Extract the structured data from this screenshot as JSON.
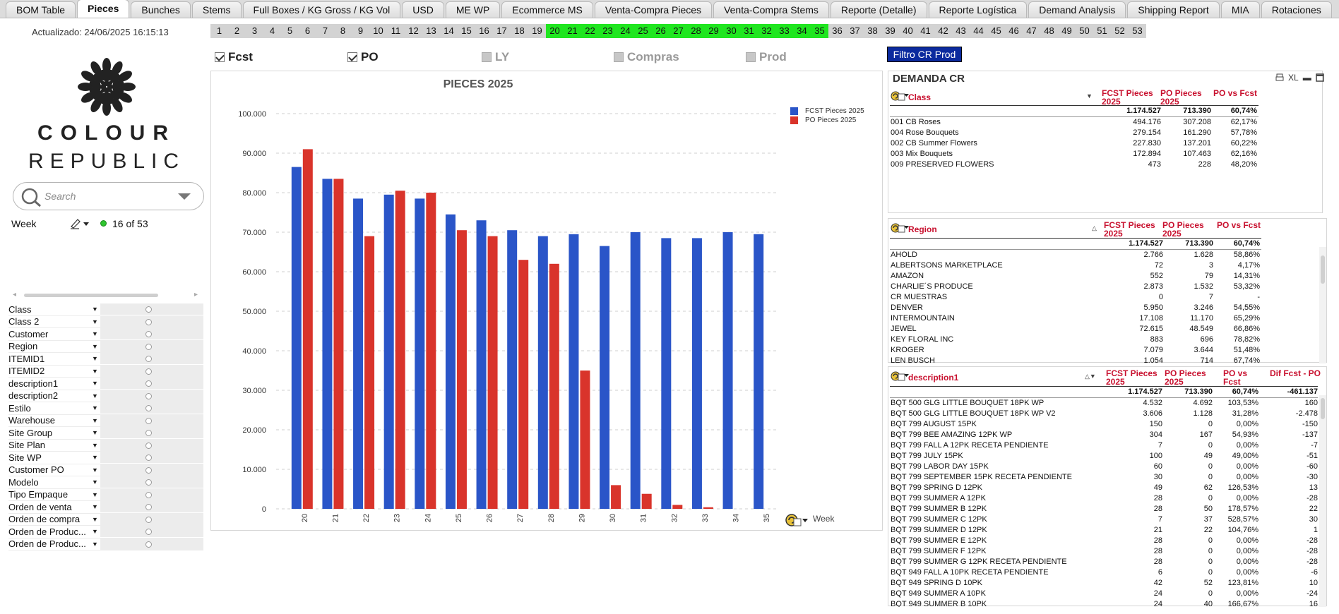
{
  "tabs": [
    "BOM Table",
    "Pieces",
    "Bunches",
    "Stems",
    "Full Boxes / KG Gross / KG Vol",
    "USD",
    "ME WP",
    "Ecommerce MS",
    "Venta-Compra Pieces",
    "Venta-Compra Stems",
    "Reporte (Detalle)",
    "Reporte Logística",
    "Demand Analysis",
    "Shipping Report",
    "MIA",
    "Rotaciones"
  ],
  "active_tab": "Pieces",
  "updated": "Actualizado: 24/06/2025     16:15:13",
  "logo": {
    "line1": "COLOUR",
    "line2": "REPUBLIC"
  },
  "search": {
    "placeholder": "Search"
  },
  "week_filter": {
    "label": "Week",
    "count": "16 of 53"
  },
  "filters": [
    "Class",
    "Class 2",
    "Customer",
    "Region",
    "ITEMID1",
    "ITEMID2",
    "description1",
    "description2",
    "Estilo",
    "Warehouse",
    "Site Group",
    "Site Plan",
    "Site WP",
    "Customer PO",
    "Modelo",
    "Tipo Empaque",
    "Orden de venta",
    "Orden de compra",
    "Orden de Produc...",
    "Orden de Produc..."
  ],
  "weeks": [
    "1",
    "2",
    "3",
    "4",
    "5",
    "6",
    "7",
    "8",
    "9",
    "10",
    "11",
    "12",
    "13",
    "14",
    "15",
    "16",
    "17",
    "18",
    "19",
    "20",
    "21",
    "22",
    "23",
    "24",
    "25",
    "26",
    "27",
    "28",
    "29",
    "30",
    "31",
    "32",
    "33",
    "34",
    "35",
    "36",
    "37",
    "38",
    "39",
    "40",
    "41",
    "42",
    "43",
    "44",
    "45",
    "46",
    "47",
    "48",
    "49",
    "50",
    "51",
    "52",
    "53"
  ],
  "selected_weeks": [
    "20",
    "21",
    "22",
    "23",
    "24",
    "25",
    "26",
    "27",
    "28",
    "29",
    "30",
    "31",
    "32",
    "33",
    "34",
    "35"
  ],
  "checkboxes": [
    {
      "label": "Fcst",
      "checked": true
    },
    {
      "label": "PO",
      "checked": true
    },
    {
      "label": "LY",
      "checked": false
    },
    {
      "label": "Compras",
      "checked": false
    },
    {
      "label": "Prod",
      "checked": false
    }
  ],
  "filter_button": "Filtro CR Prod",
  "colors": {
    "fcst": "#2a55c8",
    "po": "#d9342b",
    "selected_week": "#20e620",
    "header_red": "#c8102e"
  },
  "chart_data": {
    "type": "bar",
    "title": "PIECES 2025",
    "xlabel": "Week",
    "ylim": [
      0,
      100000
    ],
    "yticks": [
      "0",
      "10.000",
      "20.000",
      "30.000",
      "40.000",
      "50.000",
      "60.000",
      "70.000",
      "80.000",
      "90.000",
      "100.000"
    ],
    "categories": [
      "20",
      "21",
      "22",
      "23",
      "24",
      "25",
      "26",
      "27",
      "28",
      "29",
      "30",
      "31",
      "32",
      "33",
      "34",
      "35"
    ],
    "series": [
      {
        "name": "FCST Pieces 2025",
        "values": [
          86500,
          83500,
          78500,
          79500,
          78500,
          74500,
          73000,
          70500,
          69000,
          69500,
          66500,
          70000,
          68500,
          68500,
          70000,
          69500
        ]
      },
      {
        "name": "PO Pieces 2025",
        "values": [
          91000,
          83500,
          69000,
          80500,
          80000,
          70500,
          69000,
          63000,
          62000,
          35000,
          6000,
          3800,
          1000,
          400,
          0,
          0
        ]
      }
    ]
  },
  "demanda": {
    "title": "DEMANDA CR",
    "toolbar": "XL",
    "class_table": {
      "headers": [
        "Class",
        "FCST Pieces 2025",
        "PO Pieces 2025",
        "PO vs Fcst"
      ],
      "total": [
        "1.174.527",
        "713.390",
        "60,74%"
      ],
      "rows": [
        [
          "001 CB Roses",
          "494.176",
          "307.208",
          "62,17%"
        ],
        [
          "004 Rose Bouquets",
          "279.154",
          "161.290",
          "57,78%"
        ],
        [
          "002 CB Summer Flowers",
          "227.830",
          "137.201",
          "60,22%"
        ],
        [
          "003 Mix Bouquets",
          "172.894",
          "107.463",
          "62,16%"
        ],
        [
          "009 PRESERVED FLOWERS",
          "473",
          "228",
          "48,20%"
        ]
      ]
    },
    "region_table": {
      "headers": [
        "Region",
        "FCST Pieces 2025",
        "PO Pieces 2025",
        "PO vs Fcst"
      ],
      "total": [
        "1.174.527",
        "713.390",
        "60,74%"
      ],
      "rows": [
        [
          "AHOLD",
          "2.766",
          "1.628",
          "58,86%"
        ],
        [
          "ALBERTSONS MARKETPLACE",
          "72",
          "3",
          "4,17%"
        ],
        [
          "AMAZON",
          "552",
          "79",
          "14,31%"
        ],
        [
          "CHARLIE´S PRODUCE",
          "2.873",
          "1.532",
          "53,32%"
        ],
        [
          "CR MUESTRAS",
          "0",
          "7",
          "-"
        ],
        [
          "DENVER",
          "5.950",
          "3.246",
          "54,55%"
        ],
        [
          "INTERMOUNTAIN",
          "17.108",
          "11.170",
          "65,29%"
        ],
        [
          "JEWEL",
          "72.615",
          "48.549",
          "66,86%"
        ],
        [
          "KEY FLORAL INC",
          "883",
          "696",
          "78,82%"
        ],
        [
          "KROGER",
          "7.079",
          "3.644",
          "51,48%"
        ],
        [
          "LEN BUSCH",
          "1.054",
          "714",
          "67,74%"
        ]
      ]
    },
    "desc_table": {
      "headers": [
        "description1",
        "FCST Pieces 2025",
        "PO Pieces 2025",
        "PO vs Fcst",
        "Dif Fcst - PO"
      ],
      "total": [
        "1.174.527",
        "713.390",
        "60,74%",
        "-461.137"
      ],
      "rows": [
        [
          "BQT 500 GLG LITTLE BOUQUET 18PK WP",
          "4.532",
          "4.692",
          "103,53%",
          "160"
        ],
        [
          "BQT 500 GLG LITTLE BOUQUET 18PK WP V2",
          "3.606",
          "1.128",
          "31,28%",
          "-2.478"
        ],
        [
          "BQT 799 AUGUST 15PK",
          "150",
          "0",
          "0,00%",
          "-150"
        ],
        [
          "BQT 799 BEE AMAZING 12PK WP",
          "304",
          "167",
          "54,93%",
          "-137"
        ],
        [
          "BQT 799 FALL A 12PK RECETA PENDIENTE",
          "7",
          "0",
          "0,00%",
          "-7"
        ],
        [
          "BQT 799 JULY 15PK",
          "100",
          "49",
          "49,00%",
          "-51"
        ],
        [
          "BQT 799 LABOR DAY 15PK",
          "60",
          "0",
          "0,00%",
          "-60"
        ],
        [
          "BQT 799 SEPTEMBER 15PK RECETA PENDIENTE",
          "30",
          "0",
          "0,00%",
          "-30"
        ],
        [
          "BQT 799 SPRING D 12PK",
          "49",
          "62",
          "126,53%",
          "13"
        ],
        [
          "BQT 799 SUMMER A 12PK",
          "28",
          "0",
          "0,00%",
          "-28"
        ],
        [
          "BQT 799 SUMMER B 12PK",
          "28",
          "50",
          "178,57%",
          "22"
        ],
        [
          "BQT 799 SUMMER C 12PK",
          "7",
          "37",
          "528,57%",
          "30"
        ],
        [
          "BQT 799 SUMMER D 12PK",
          "21",
          "22",
          "104,76%",
          "1"
        ],
        [
          "BQT 799 SUMMER E 12PK",
          "28",
          "0",
          "0,00%",
          "-28"
        ],
        [
          "BQT 799 SUMMER F 12PK",
          "28",
          "0",
          "0,00%",
          "-28"
        ],
        [
          "BQT 799 SUMMER G 12PK RECETA PENDIENTE",
          "28",
          "0",
          "0,00%",
          "-28"
        ],
        [
          "BQT 949 FALL A 10PK RECETA PENDIENTE",
          "6",
          "0",
          "0,00%",
          "-6"
        ],
        [
          "BQT 949 SPRING D 10PK",
          "42",
          "52",
          "123,81%",
          "10"
        ],
        [
          "BQT 949 SUMMER A 10PK",
          "24",
          "0",
          "0,00%",
          "-24"
        ],
        [
          "BQT 949 SUMMER B 10PK",
          "24",
          "40",
          "166,67%",
          "16"
        ]
      ]
    }
  }
}
